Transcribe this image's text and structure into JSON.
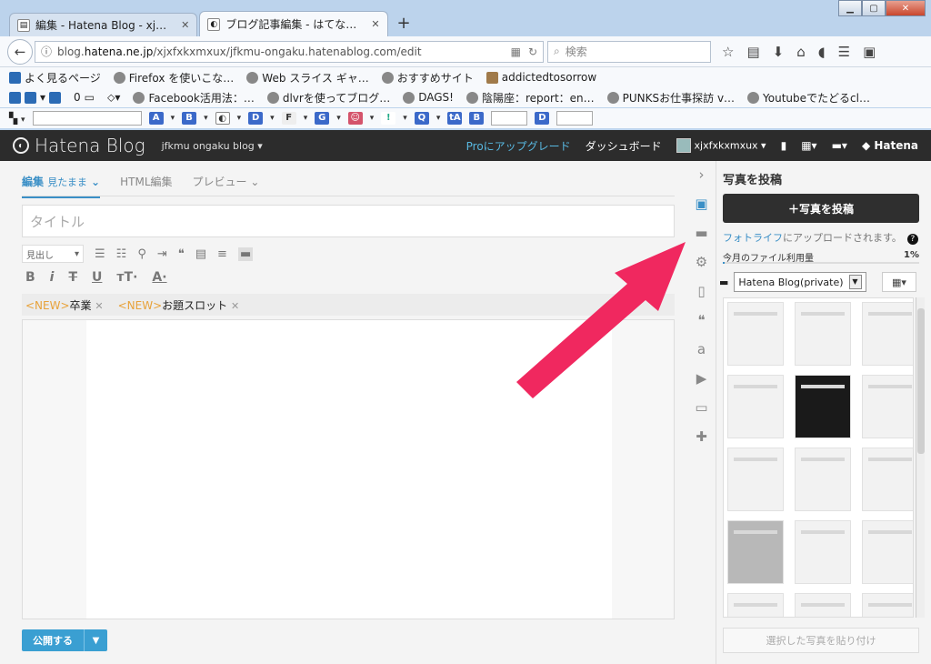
{
  "browser": {
    "tabs": [
      {
        "label": "編集 - Hatena Blog - xj…"
      },
      {
        "label": "ブログ記事編集 - はてな…"
      }
    ],
    "url": {
      "prefix": "blog.",
      "host": "hatena.ne.jp",
      "path": "/xjxfxkxmxux/jfkmu-ongaku.hatenablog.com/edit"
    },
    "search_placeholder": "検索",
    "bookmarks_row1": [
      "よく見るページ",
      "Firefox を使いこな…",
      "Web スライス ギャ…",
      "おすすめサイト",
      "addictedtosorrow"
    ],
    "bookmarks_row2": [
      "Facebook活用法：…",
      "dlvrを使ってブログ…",
      "DAGS!",
      "陰陽座：report：en…",
      "PUNKSお仕事探訪 v…",
      "Youtubeでたどるcl…"
    ],
    "bookmarks_row2_count": "0"
  },
  "hatena": {
    "logo": "Hatena Blog",
    "blog_name": "jfkmu ongaku blog ▾",
    "upgrade": "Proにアップグレード",
    "dashboard": "ダッシュボード",
    "user": "xjxfxkxmxux ▾",
    "brand": "Hatena"
  },
  "editor": {
    "tab_edit": "編集",
    "tab_edit_mode": "見たまま",
    "tab_html": "HTML編集",
    "tab_preview": "プレビュー",
    "title_placeholder": "タイトル",
    "heading_select": "見出し",
    "tags": [
      {
        "new": "<NEW>",
        "label": "卒業"
      },
      {
        "new": "<NEW>",
        "label": "お題スロット"
      }
    ],
    "publish": "公開する"
  },
  "panel": {
    "title": "写真を投稿",
    "upload_button": "＋写真を投稿",
    "note_link": "フォトライフ",
    "note_text": "にアップロードされます。",
    "usage_label": "今月のファイル利用量",
    "usage_value": "1%",
    "usage_fraction": 0.01,
    "album": "Hatena Blog(private)",
    "paste_button": "選択した写真を貼り付け"
  },
  "colors": {
    "accent": "#3a8fc6",
    "header_bg": "#2c2c2c",
    "arrow": "#f0285f"
  }
}
